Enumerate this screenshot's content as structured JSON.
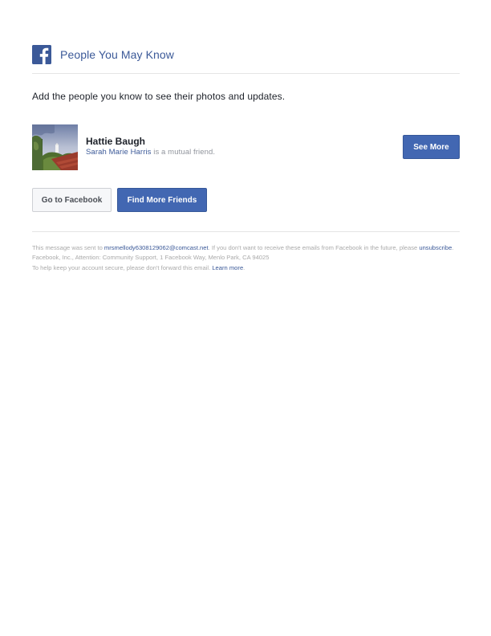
{
  "header": {
    "title": "People You May Know"
  },
  "intro": "Add the people you know to see their photos and updates.",
  "suggestion": {
    "name": "Hattie Baugh",
    "mutual_friend": "Sarah Marie Harris",
    "mutual_suffix": " is a mutual friend.",
    "action_label": "See More"
  },
  "actions": {
    "go_to_facebook": "Go to Facebook",
    "find_more_friends": "Find More Friends"
  },
  "footer": {
    "sent_prefix": "This message was sent to ",
    "email": "mrsmellody6308129062@comcast.net",
    "sent_suffix": ". If you don't want to receive these emails from Facebook in the future, please ",
    "unsubscribe": "unsubscribe",
    "unsubscribe_suffix": ".",
    "address": "Facebook, Inc., Attention: Community Support, 1 Facebook Way, Menlo Park, CA 94025",
    "security_text": "To help keep your account secure, please don't forward this email. ",
    "learn_more": "Learn more"
  },
  "colors": {
    "brand": "#3b5998",
    "button_primary": "#4267b2",
    "text_secondary": "#90949c"
  },
  "icons": {
    "logo": "facebook-logo-icon"
  }
}
